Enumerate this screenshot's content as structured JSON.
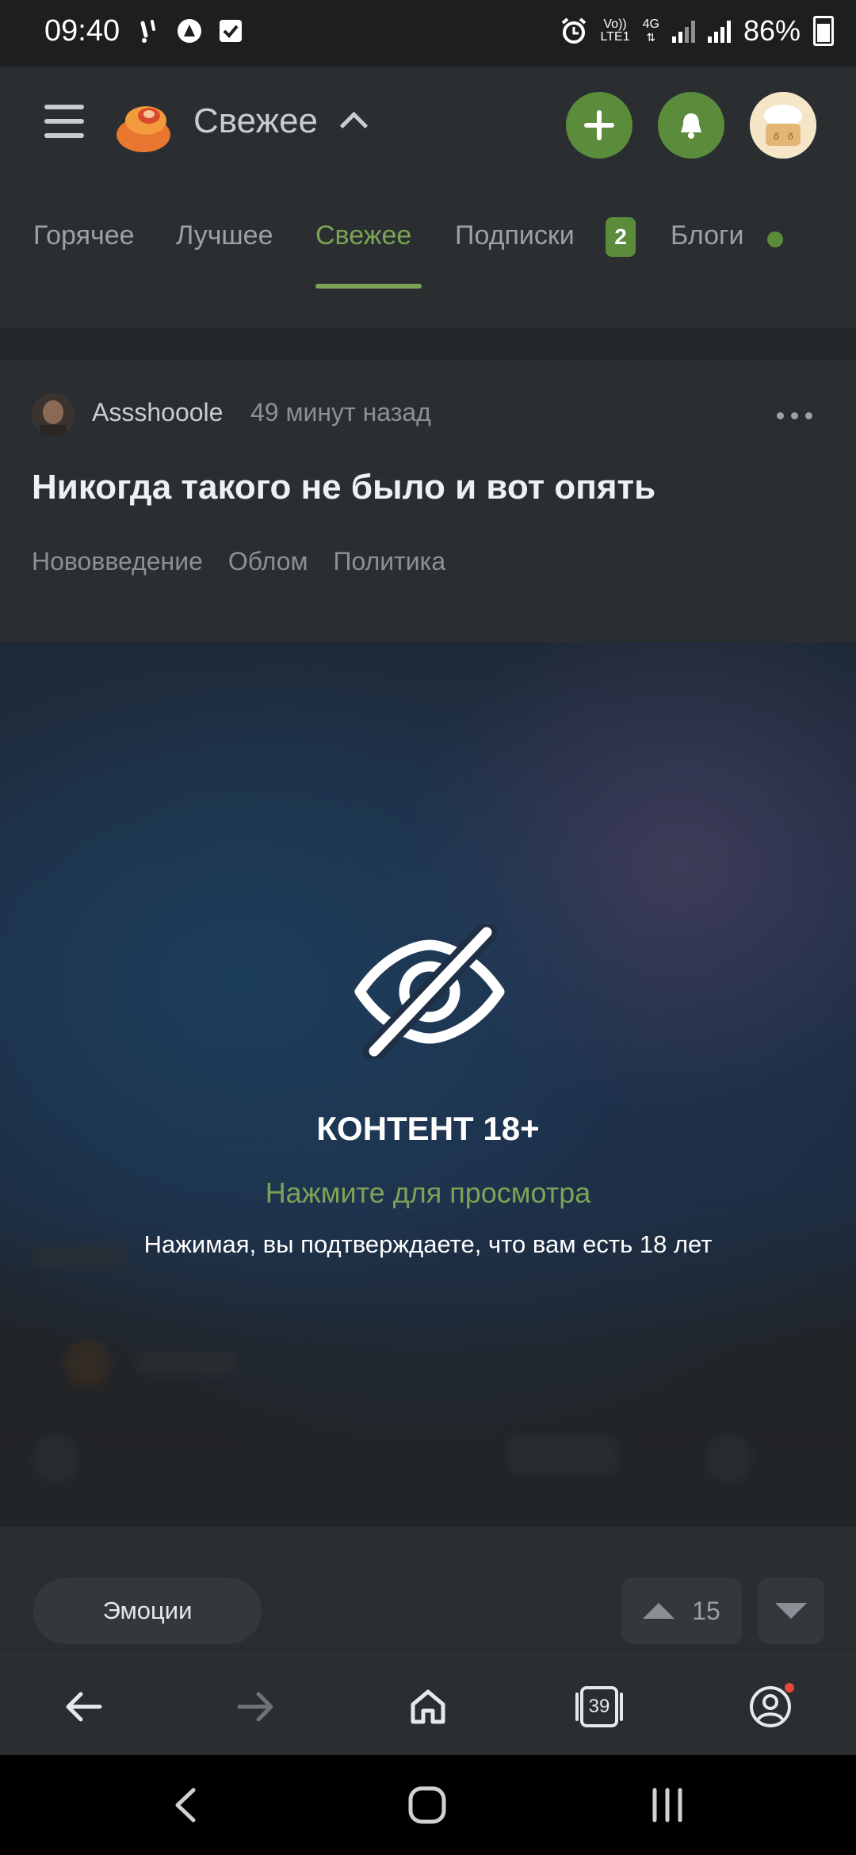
{
  "status_bar": {
    "time": "09:40",
    "left_icons": [
      "wifi-call-icon",
      "vpn-icon",
      "checkbox-icon"
    ],
    "network_top": "Vo))",
    "network_bottom": "LTE1",
    "network_type": "4G",
    "battery": "86%"
  },
  "header": {
    "title": "Свежее",
    "add_icon": "plus-icon",
    "bell_icon": "bell-icon"
  },
  "tabs": {
    "items": [
      {
        "label": "Горячее"
      },
      {
        "label": "Лучшее"
      },
      {
        "label": "Свежее"
      },
      {
        "label": "Подписки",
        "badge": "2"
      },
      {
        "label": "Блоги"
      }
    ],
    "active": "Свежее"
  },
  "post": {
    "author": "Assshooole",
    "time_ago": "49 минут назад",
    "title": "Никогда такого не было и вот опять",
    "tags": [
      "Нововведение",
      "Облом",
      "Политика"
    ]
  },
  "nsfw": {
    "title": "КОНТЕНТ 18+",
    "cta": "Нажмите для просмотра",
    "note": "Нажимая, вы подтверждаете, что вам есть 18 лет"
  },
  "actions": {
    "emotions_label": "Эмоции",
    "rating": "15"
  },
  "browser_nav": {
    "tabs_count": "39"
  },
  "colors": {
    "accent": "#7ca356",
    "button_green": "#5b8c3b",
    "background": "#2a2e31"
  }
}
